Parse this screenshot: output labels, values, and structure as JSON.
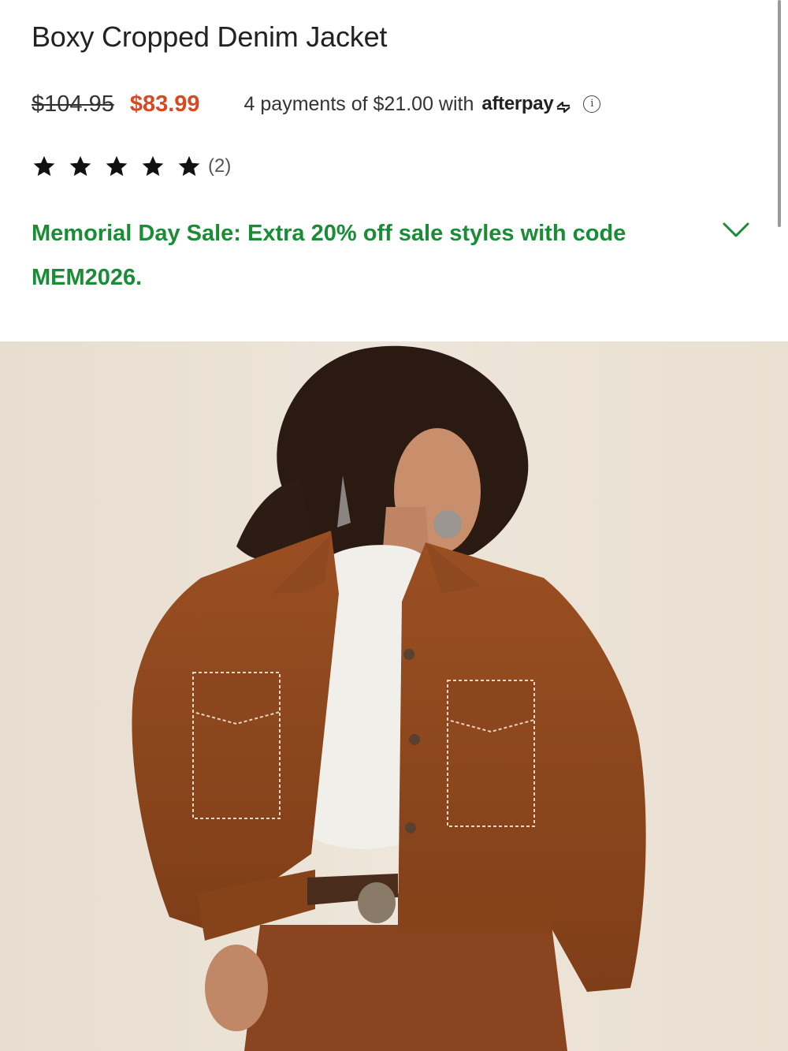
{
  "product": {
    "title": "Boxy Cropped Denim Jacket",
    "price_original": "$104.95",
    "price_sale": "$83.99",
    "sale_color": "#d9481f"
  },
  "afterpay": {
    "text": "4 payments of $21.00 with",
    "brand": "afterpay",
    "logo_icon": "afterpay-arrows-icon",
    "info_icon": "info-circle-icon"
  },
  "rating": {
    "stars": 5,
    "max_stars": 5,
    "review_count": "(2)"
  },
  "promo": {
    "text": "Memorial Day Sale: Extra 20% off sale styles with code MEM2026.",
    "color": "#1a8c36",
    "toggle_icon": "chevron-down-icon"
  },
  "hero_image": {
    "description_icon": "product-photo"
  }
}
